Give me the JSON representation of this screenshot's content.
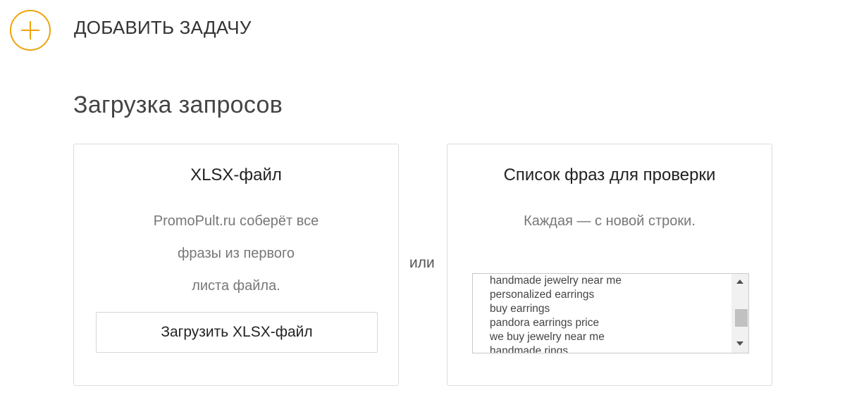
{
  "header": {
    "add_task_label": "ДОБАВИТЬ ЗАДАЧУ",
    "add_task_icon": "plus-circle-icon",
    "accent_color": "#f0a30a"
  },
  "section": {
    "title": "Загрузка запросов"
  },
  "xlsx_panel": {
    "title": "XLSX-файл",
    "description_lines": [
      "PromoPult.ru соберёт все",
      "фразы из первого",
      "листа файла."
    ],
    "upload_button_label": "Загрузить XLSX-файл"
  },
  "separator": {
    "or_label": "или"
  },
  "phrases_panel": {
    "title": "Список фраз для проверки",
    "description": "Каждая — с новой строки.",
    "phrases": [
      "handmade jewelry near me",
      "personalized earrings",
      "buy earrings",
      "pandora earrings price",
      "we buy jewelry near me",
      "handmade rings"
    ]
  }
}
